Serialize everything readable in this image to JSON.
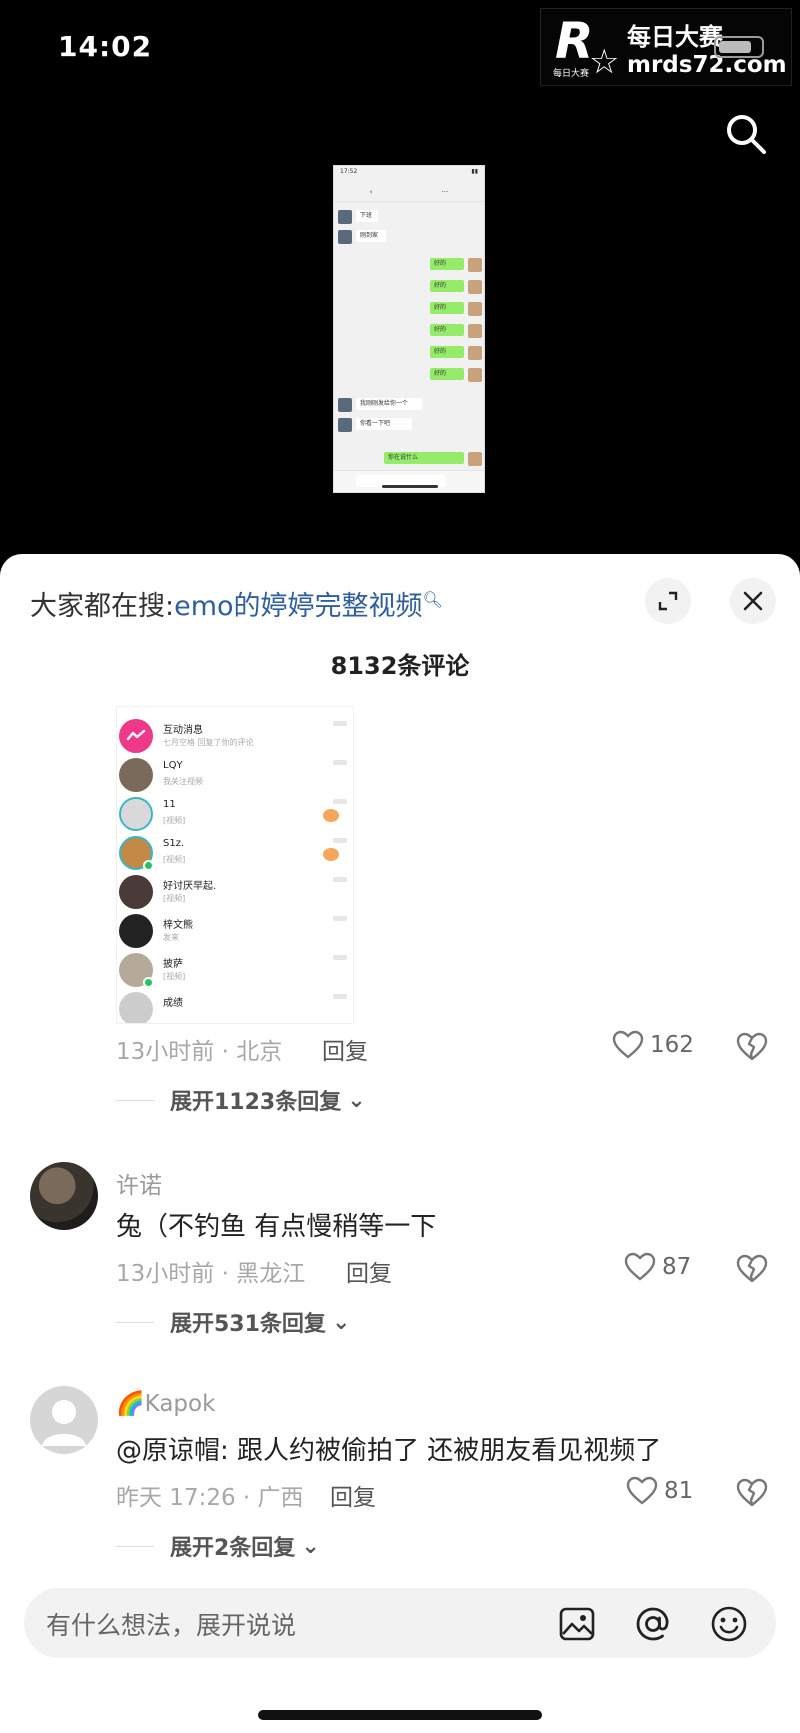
{
  "status_bar": {
    "time": "14:02"
  },
  "watermark": {
    "logo_letter": "R",
    "logo_sub": "每日大赛",
    "title": "每日大赛",
    "url": "mrds72.com"
  },
  "video": {
    "title": "",
    "messages": [
      {
        "side": "left",
        "text": "下班了"
      },
      {
        "side": "left",
        "text": "刚到家了"
      },
      {
        "side": "right",
        "text": "好的"
      },
      {
        "side": "right",
        "text": "好的"
      },
      {
        "side": "right",
        "text": "好的"
      },
      {
        "side": "right",
        "text": "好的"
      },
      {
        "side": "right",
        "text": "好的"
      },
      {
        "side": "right",
        "text": "好的"
      },
      {
        "side": "left",
        "text": "我刚刚发给你一个"
      },
      {
        "side": "left",
        "text": "你看一下吧"
      },
      {
        "side": "right",
        "text": "你在说什么"
      }
    ]
  },
  "sheet": {
    "trend_prefix": "大家都在搜:",
    "trend_link": "emo的婷婷完整视频",
    "comment_count": "8132条评论"
  },
  "image_comment": {
    "inbox": [
      {
        "name": "互动消息",
        "sub": "七月空格 回复了你的评论",
        "avatar_color": "#f0388a",
        "badge": false,
        "online": false
      },
      {
        "name": "LQY",
        "sub": "我关注视频",
        "avatar_color": "#7a6a5a",
        "badge": false,
        "online": false
      },
      {
        "name": "11",
        "sub": "[视频]",
        "avatar_color": "#d9d9d9",
        "badge": true,
        "online": false
      },
      {
        "name": "S1z.",
        "sub": "[视频]",
        "avatar_color": "#c28a45",
        "badge": true,
        "online": true
      },
      {
        "name": "好讨厌早起.",
        "sub": "[视频]",
        "avatar_color": "#4a3a3a",
        "badge": false,
        "online": false
      },
      {
        "name": "梓文熊",
        "sub": "发来",
        "avatar_color": "#222222",
        "badge": false,
        "online": false
      },
      {
        "name": "披萨",
        "sub": "[视频]",
        "avatar_color": "#b5a99a",
        "badge": false,
        "online": true
      },
      {
        "name": "成绩",
        "sub": "",
        "avatar_color": "#cccccc",
        "badge": false,
        "online": false
      }
    ],
    "meta": "13小时前 · 北京",
    "reply": "回复",
    "likes": "162",
    "expand": "展开1123条回复"
  },
  "comments": [
    {
      "username": "许诺",
      "text": "兔（不钓鱼 有点慢稍等一下",
      "meta": "13小时前 · 黑龙江",
      "reply": "回复",
      "likes": "87",
      "expand": "展开531条回复"
    },
    {
      "username": "Kapok",
      "username_prefix_icon": "rainbow-emoji",
      "text": "@原谅帽: 跟人约被偷拍了 还被朋友看见视频了",
      "meta": "昨天 17:26 · 广西",
      "reply": "回复",
      "likes": "81",
      "expand": "展开2条回复"
    }
  ],
  "input": {
    "placeholder": "有什么想法，展开说说"
  },
  "icons": {
    "search": "search-icon",
    "expand": "expand-icon",
    "close": "close-icon",
    "like": "heart-icon",
    "dislike": "broken-heart-icon",
    "image": "image-icon",
    "mention": "at-icon",
    "emoji": "emoji-icon"
  },
  "colors": {
    "link": "#2f5f9b",
    "background_top": "#000000",
    "sheet": "#ffffff",
    "input_bg": "#f2f2f2"
  }
}
